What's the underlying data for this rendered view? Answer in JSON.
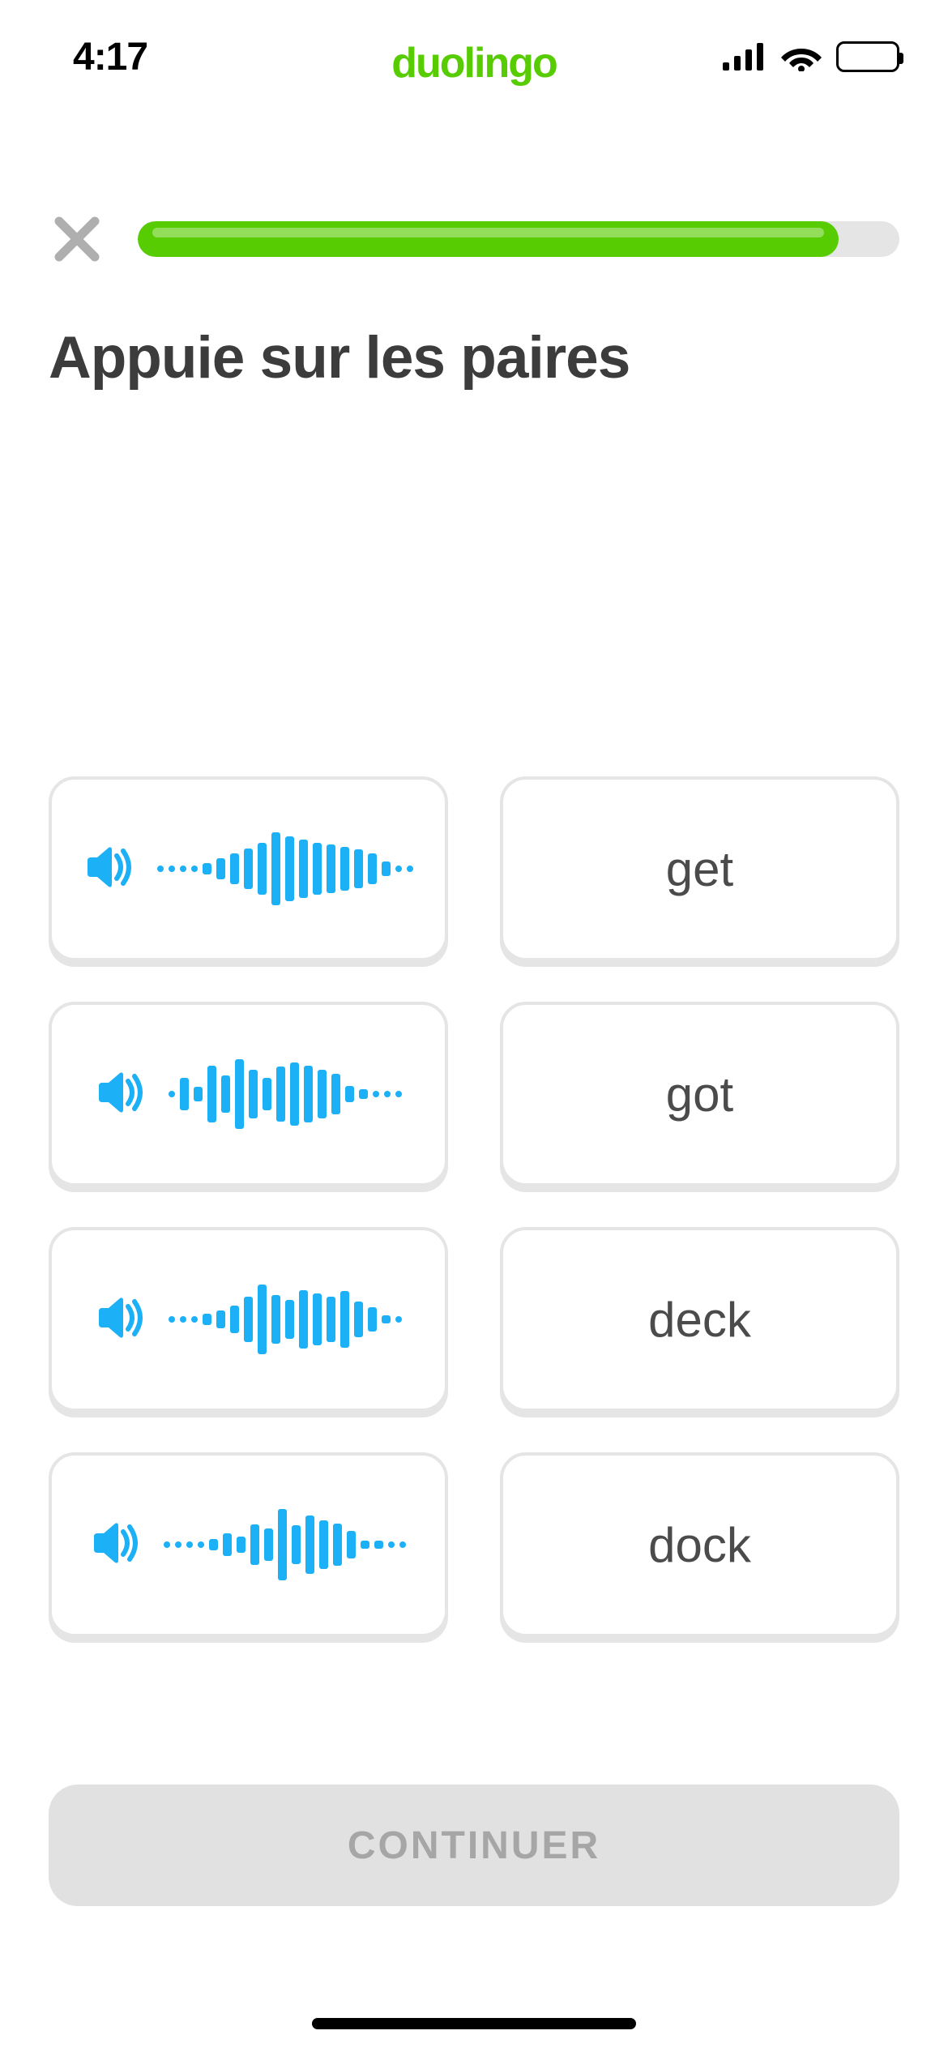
{
  "status": {
    "time": "4:17",
    "logo": "duolingo"
  },
  "colors": {
    "green": "#58cc02",
    "blue": "#1cb0f6"
  },
  "progress_percent": 92,
  "prompt": "Appuie sur les paires",
  "audio_cards": [
    {
      "wave_heights": [
        6,
        6,
        6,
        6,
        14,
        26,
        38,
        50,
        64,
        90,
        80,
        72,
        64,
        60,
        54,
        48,
        38,
        18,
        6,
        6
      ]
    },
    {
      "wave_heights": [
        6,
        40,
        18,
        70,
        46,
        86,
        60,
        40,
        68,
        78,
        70,
        60,
        50,
        20,
        12,
        8,
        6,
        6
      ]
    },
    {
      "wave_heights": [
        6,
        6,
        6,
        14,
        22,
        34,
        56,
        86,
        60,
        48,
        72,
        64,
        56,
        70,
        44,
        30,
        10,
        6
      ]
    },
    {
      "wave_heights": [
        6,
        6,
        6,
        6,
        14,
        28,
        20,
        50,
        40,
        88,
        48,
        72,
        60,
        52,
        34,
        10,
        10,
        6,
        6
      ]
    }
  ],
  "word_cards": [
    "get",
    "got",
    "deck",
    "dock"
  ],
  "continue_label": "CONTINUER"
}
